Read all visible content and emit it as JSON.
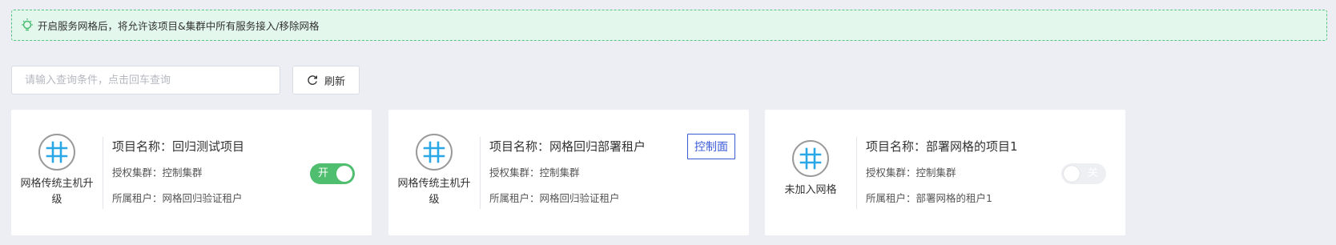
{
  "notice": {
    "icon": "lightbulb-icon",
    "text": "开启服务网格后，将允许该项目&集群中所有服务接入/移除网格"
  },
  "search": {
    "placeholder": "请输入查询条件，点击回车查询",
    "value": ""
  },
  "toolbar": {
    "refresh_label": "刷新",
    "refresh_icon": "refresh-icon"
  },
  "colors": {
    "accent_green": "#4fbe6f",
    "badge_blue": "#3b5bd9",
    "grid_icon_blue": "#2aa7e6",
    "notice_bg": "#e3f7ec"
  },
  "cards": [
    {
      "state_label": "网格传统主机升级",
      "project_name": "项目名称：回归测试项目",
      "cluster": "授权集群：控制集群",
      "tenant": "所属租户：网格回归验证租户",
      "toggle": {
        "state": "on",
        "label": "开"
      }
    },
    {
      "state_label": "网格传统主机升级",
      "project_name": "项目名称：网格回归部署租户",
      "cluster": "授权集群：控制集群",
      "tenant": "所属租户：网格回归验证租户",
      "badge": "控制面"
    },
    {
      "state_label": "未加入网格",
      "project_name": "项目名称：部署网格的项目1",
      "cluster": "授权集群：控制集群",
      "tenant": "所属租户：部署网格的租户1",
      "toggle": {
        "state": "off",
        "label": "关"
      }
    }
  ]
}
